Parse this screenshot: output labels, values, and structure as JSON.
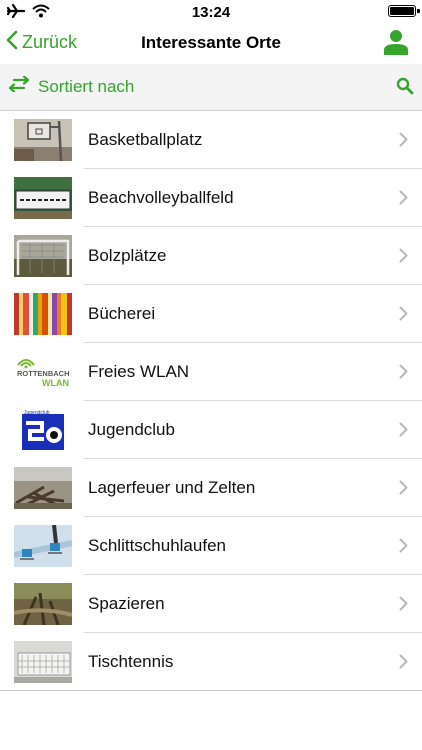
{
  "status_bar": {
    "time": "13:24"
  },
  "nav": {
    "back_label": "Zurück",
    "title": "Interessante Orte"
  },
  "sort_bar": {
    "label": "Sortiert nach"
  },
  "colors": {
    "accent": "#35a52b",
    "separator": "#dadada",
    "bar_background": "#f4f4f4"
  },
  "items": [
    {
      "label": "Basketballplatz",
      "thumbnail": "basketball-court-photo"
    },
    {
      "label": "Beachvolleyballfeld",
      "thumbnail": "beach-volleyball-sign-photo"
    },
    {
      "label": "Bolzplätze",
      "thumbnail": "football-goal-photo"
    },
    {
      "label": "Bücherei",
      "thumbnail": "bookshelf-photo"
    },
    {
      "label": "Freies WLAN",
      "thumbnail": "rottenbach-wlan-logo",
      "logo_text": [
        "ROTTENBACH",
        "WLAN"
      ]
    },
    {
      "label": "Jugendclub",
      "thumbnail": "jugendclub-logo"
    },
    {
      "label": "Lagerfeuer und Zelten",
      "thumbnail": "campfire-wood-photo"
    },
    {
      "label": "Schlittschuhlaufen",
      "thumbnail": "ice-skating-photo"
    },
    {
      "label": "Spazieren",
      "thumbnail": "forest-path-photo"
    },
    {
      "label": "Tischtennis",
      "thumbnail": "table-tennis-photo"
    }
  ]
}
